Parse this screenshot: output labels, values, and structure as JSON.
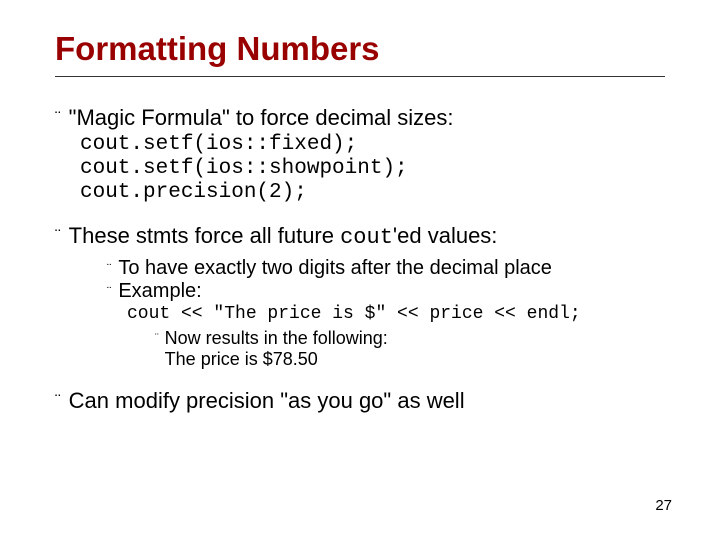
{
  "title": "Formatting Numbers",
  "b1": {
    "magic": "\"Magic Formula\" to force decimal sizes:",
    "code1": "cout.setf(ios::fixed);",
    "code2": "cout.setf(ios::showpoint);",
    "code3": "cout.precision(2);",
    "stmts_a": "These stmts force all future ",
    "stmts_code": "cout",
    "stmts_b": "'ed values:",
    "modify": "Can modify precision \"as you go\" as well"
  },
  "b2": {
    "twodigits": "To have exactly two digits after the decimal place",
    "example": "Example:",
    "excode": "cout << \"The price is $\" << price << endl;"
  },
  "b3": {
    "now": "Now results in the following:",
    "price": "The price is $78.50"
  },
  "pagenum": "27"
}
